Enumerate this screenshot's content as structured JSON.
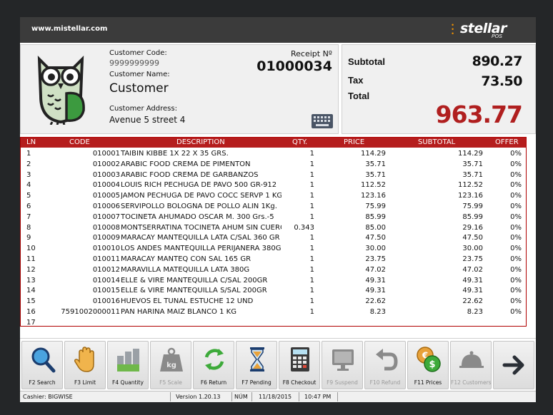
{
  "header": {
    "site": "www.mistellar.com",
    "logo_text": "stellar",
    "logo_sub": "POS"
  },
  "customer": {
    "code_label": "Customer Code:",
    "code": "9999999999",
    "name_label": "Customer Name:",
    "name": "Customer",
    "address_label": "Customer Address:",
    "address": "Avenue 5 street 4",
    "receipt_label": "Receipt Nº",
    "receipt_no": "01000034"
  },
  "totals": {
    "subtotal_label": "Subtotal",
    "subtotal": "890.27",
    "tax_label": "Tax",
    "tax": "73.50",
    "total_label": "Total",
    "total": "963.77"
  },
  "grid": {
    "headers": {
      "ln": "LN",
      "code": "CODE",
      "description": "DESCRIPTION",
      "qty": "QTY.",
      "price": "PRICE",
      "subtotal": "SUBTOTAL",
      "offer": "OFFER"
    },
    "rows": [
      {
        "ln": "1",
        "code": "010001",
        "description": "TAIBIN KIBBE 1X 22 X 35  GRS.",
        "qty": "1",
        "price": "114.29",
        "subtotal": "114.29",
        "offer": "0%"
      },
      {
        "ln": "2",
        "code": "010002",
        "description": "ARABIC FOOD CREMA DE PIMENTON",
        "qty": "1",
        "price": "35.71",
        "subtotal": "35.71",
        "offer": "0%"
      },
      {
        "ln": "3",
        "code": "010003",
        "description": "ARABIC FOOD CREMA DE GARBANZOS",
        "qty": "1",
        "price": "35.71",
        "subtotal": "35.71",
        "offer": "0%"
      },
      {
        "ln": "4",
        "code": "010004",
        "description": "LOUIS RICH PECHUGA DE PAVO 500 GR-912",
        "qty": "1",
        "price": "112.52",
        "subtotal": "112.52",
        "offer": "0%"
      },
      {
        "ln": "5",
        "code": "010005",
        "description": "JAMON PECHUGA DE PAVO COCC SERVP 1 KG",
        "qty": "1",
        "price": "123.16",
        "subtotal": "123.16",
        "offer": "0%"
      },
      {
        "ln": "6",
        "code": "010006",
        "description": "SERVIPOLLO BOLOGNA DE POLLO ALIN 1Kg.",
        "qty": "1",
        "price": "75.99",
        "subtotal": "75.99",
        "offer": "0%"
      },
      {
        "ln": "7",
        "code": "010007",
        "description": "TOCINETA  AHUMADO OSCAR M. 300 Grs.-5",
        "qty": "1",
        "price": "85.99",
        "subtotal": "85.99",
        "offer": "0%"
      },
      {
        "ln": "8",
        "code": "010008",
        "description": "MONTSERRATINA TOCINETA AHUM SIN CUERO",
        "qty": "0.343",
        "price": "85.00",
        "subtotal": "29.16",
        "offer": "0%"
      },
      {
        "ln": "9",
        "code": "010009",
        "description": "MARACAY  MANTEQUILLA  LATA  C/SAL 360 GR",
        "qty": "1",
        "price": "47.50",
        "subtotal": "47.50",
        "offer": "0%"
      },
      {
        "ln": "10",
        "code": "010010",
        "description": "LOS ANDES MANTEQUILLA PERIJANERA 380G",
        "qty": "1",
        "price": "30.00",
        "subtotal": "30.00",
        "offer": "0%"
      },
      {
        "ln": "11",
        "code": "010011",
        "description": "MARACAY  MANTEQ CON SAL 165  GR",
        "qty": "1",
        "price": "23.75",
        "subtotal": "23.75",
        "offer": "0%"
      },
      {
        "ln": "12",
        "code": "010012",
        "description": "MARAVILLA MATEQUILLA LATA 380G",
        "qty": "1",
        "price": "47.02",
        "subtotal": "47.02",
        "offer": "0%"
      },
      {
        "ln": "13",
        "code": "010014",
        "description": "ELLE & VIRE MANTEQUILLA C/SAL 200GR",
        "qty": "1",
        "price": "49.31",
        "subtotal": "49.31",
        "offer": "0%"
      },
      {
        "ln": "14",
        "code": "010015",
        "description": "ELLE & VIRE MANTEQUILLA S/SAL 200GR",
        "qty": "1",
        "price": "49.31",
        "subtotal": "49.31",
        "offer": "0%"
      },
      {
        "ln": "15",
        "code": "010016",
        "description": "HUEVOS EL TUNAL ESTUCHE 12 UND",
        "qty": "1",
        "price": "22.62",
        "subtotal": "22.62",
        "offer": "0%"
      },
      {
        "ln": "16",
        "code": "7591002000011",
        "description": "PAN HARINA MAIZ BLANCO 1 KG",
        "qty": "1",
        "price": "8.23",
        "subtotal": "8.23",
        "offer": "0%"
      },
      {
        "ln": "17",
        "code": "",
        "description": "",
        "qty": "",
        "price": "",
        "subtotal": "",
        "offer": ""
      }
    ]
  },
  "toolbar": [
    {
      "label": "F2 Search",
      "icon": "search-icon",
      "enabled": true
    },
    {
      "label": "F3   Limit",
      "icon": "hand-icon",
      "enabled": true
    },
    {
      "label": "F4 Quantity",
      "icon": "quantity-icon",
      "enabled": true
    },
    {
      "label": "F5 Scale",
      "icon": "weight-icon",
      "enabled": false
    },
    {
      "label": "F6 Return",
      "icon": "refresh-icon",
      "enabled": true
    },
    {
      "label": "F7 Pending",
      "icon": "hourglass-icon",
      "enabled": true
    },
    {
      "label": "F8 Checkout",
      "icon": "calculator-icon",
      "enabled": true
    },
    {
      "label": "F9 Suspend",
      "icon": "monitor-icon",
      "enabled": false
    },
    {
      "label": "F10 Refund",
      "icon": "undo-icon",
      "enabled": false
    },
    {
      "label": "F11 Prices",
      "icon": "coins-icon",
      "enabled": true
    },
    {
      "label": "F12 Customers",
      "icon": "cloche-icon",
      "enabled": false
    },
    {
      "label": "",
      "icon": "arrow-right-icon",
      "enabled": true
    }
  ],
  "status": {
    "cashier": "Cashier: BIGWISE",
    "version": "Version 1.20.13",
    "num": "NÚM",
    "date": "11/18/2015",
    "time": "10:47 PM"
  },
  "colors": {
    "accent": "#b51d1d",
    "total": "#b01f1f",
    "titlebar": "#3b3b3b"
  }
}
